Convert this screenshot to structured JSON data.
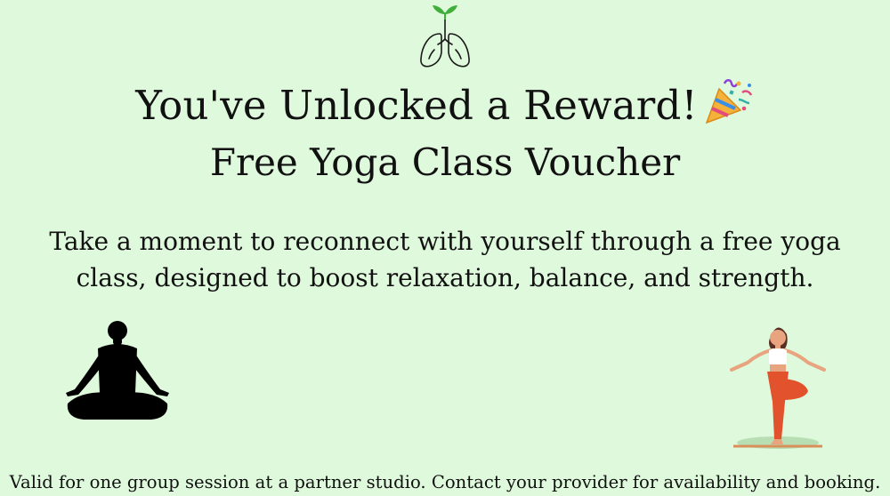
{
  "reward": {
    "headline": "You've Unlocked a Reward!",
    "subheadline": "Free Yoga Class Voucher",
    "description": "Take a moment to reconnect with yourself through a free yoga class, designed to boost relaxation, balance, and strength.",
    "footer": "Valid for one group session at a partner studio. Contact your provider for availability and booking."
  },
  "icons": {
    "top": "lungs-with-sprout-icon",
    "celebration": "party-popper-icon",
    "left_illustration": "meditation-silhouette",
    "right_illustration": "tree-pose-yoga-woman"
  },
  "colors": {
    "background": "#dff9dc",
    "text": "#111111",
    "sprout": "#3fae3a",
    "leggings": "#e1522d",
    "top_white": "#ffffff",
    "skin": "#e7a47e"
  }
}
